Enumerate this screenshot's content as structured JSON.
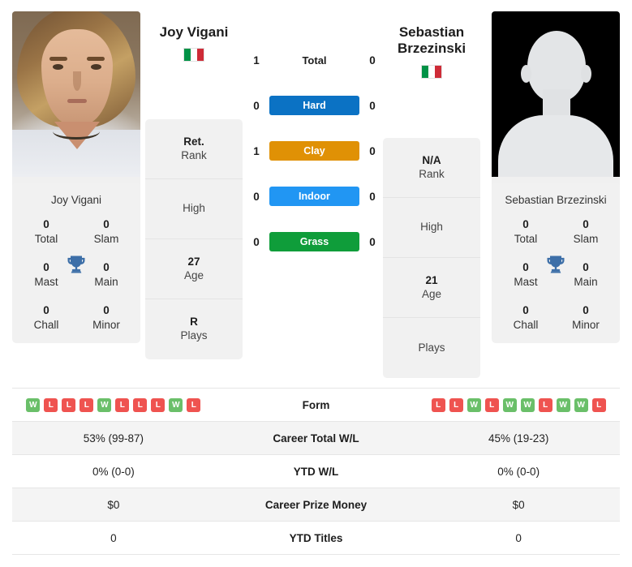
{
  "players": {
    "left": {
      "name": "Joy Vigani",
      "caption": "Joy Vigani",
      "country_flag": "italy-flag",
      "rank": "Ret.",
      "rank_label": "Rank",
      "high": "",
      "high_label": "High",
      "age": "27",
      "age_label": "Age",
      "plays": "R",
      "plays_label": "Plays",
      "titles": {
        "total": "0",
        "total_label": "Total",
        "slam": "0",
        "slam_label": "Slam",
        "mast": "0",
        "mast_label": "Mast",
        "main": "0",
        "main_label": "Main",
        "chall": "0",
        "chall_label": "Chall",
        "minor": "0",
        "minor_label": "Minor"
      },
      "form": [
        "W",
        "L",
        "L",
        "L",
        "W",
        "L",
        "L",
        "L",
        "W",
        "L"
      ],
      "career_total_wl": "53% (99-87)",
      "ytd_wl": "0% (0-0)",
      "career_prize_money": "$0",
      "ytd_titles": "0"
    },
    "right": {
      "name": "Sebastian Brzezinski",
      "caption": "Sebastian Brzezinski",
      "country_flag": "italy-flag",
      "rank": "N/A",
      "rank_label": "Rank",
      "high": "",
      "high_label": "High",
      "age": "21",
      "age_label": "Age",
      "plays": "",
      "plays_label": "Plays",
      "titles": {
        "total": "0",
        "total_label": "Total",
        "slam": "0",
        "slam_label": "Slam",
        "mast": "0",
        "mast_label": "Mast",
        "main": "0",
        "main_label": "Main",
        "chall": "0",
        "chall_label": "Chall",
        "minor": "0",
        "minor_label": "Minor"
      },
      "form": [
        "L",
        "L",
        "W",
        "L",
        "W",
        "W",
        "L",
        "W",
        "W",
        "L"
      ],
      "career_total_wl": "45% (19-23)",
      "ytd_wl": "0% (0-0)",
      "career_prize_money": "$0",
      "ytd_titles": "0"
    }
  },
  "surfaces": [
    {
      "label": "Total",
      "left": "1",
      "right": "0",
      "color": "",
      "style": "plain"
    },
    {
      "label": "Hard",
      "left": "0",
      "right": "0",
      "color": "#0b72c4",
      "style": "pill"
    },
    {
      "label": "Clay",
      "left": "1",
      "right": "0",
      "color": "#e09105",
      "style": "pill"
    },
    {
      "label": "Indoor",
      "left": "0",
      "right": "0",
      "color": "#2196f3",
      "style": "pill"
    },
    {
      "label": "Grass",
      "left": "0",
      "right": "0",
      "color": "#0f9d3a",
      "style": "pill"
    }
  ],
  "table": {
    "rows": [
      {
        "label": "Form",
        "left": "",
        "right": "",
        "kind": "form"
      },
      {
        "label": "Career Total W/L",
        "left": "53% (99-87)",
        "right": "45% (19-23)",
        "kind": "text"
      },
      {
        "label": "YTD W/L",
        "left": "0% (0-0)",
        "right": "0% (0-0)",
        "kind": "text"
      },
      {
        "label": "Career Prize Money",
        "left": "$0",
        "right": "$0",
        "kind": "text"
      },
      {
        "label": "YTD Titles",
        "left": "0",
        "right": "0",
        "kind": "text"
      }
    ]
  },
  "colors": {
    "win_badge": "#6abf69",
    "loss_badge": "#ef5350",
    "trophy": "#3d6fa8",
    "panel_bg": "#f1f1f1",
    "row_alt": "#f4f4f4"
  }
}
